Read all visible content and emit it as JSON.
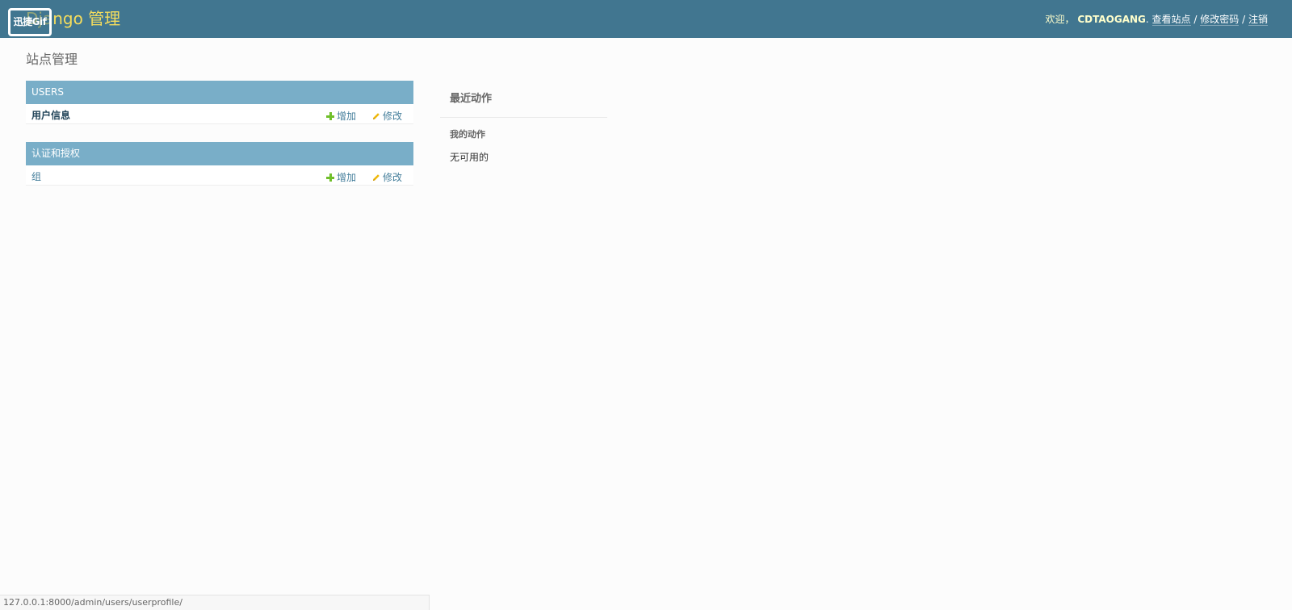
{
  "header": {
    "branding": "Django 管理",
    "watermark": "迅捷Gif",
    "welcome": "欢迎，",
    "username": "CDTAOGANG",
    "view_site": "查看站点",
    "change_password": "修改密码",
    "logout": "注销",
    "separator": "/"
  },
  "page": {
    "title": "站点管理"
  },
  "apps": [
    {
      "caption": "USERS",
      "models": [
        {
          "name": "用户信息",
          "add": "增加",
          "change": "修改"
        }
      ]
    },
    {
      "caption": "认证和授权",
      "models": [
        {
          "name": "组",
          "add": "增加",
          "change": "修改"
        }
      ]
    }
  ],
  "recent_actions": {
    "title": "最近动作",
    "my_actions": "我的动作",
    "none": "无可用的"
  },
  "status_bar": {
    "url": "127.0.0.1:8000/admin/users/userprofile/"
  },
  "colors": {
    "header_bg": "#417690",
    "branding": "#f5dd5d",
    "module_caption_bg": "#79aec8",
    "link": "#447e9b",
    "add_icon": "#70bf2b",
    "change_icon": "#efb80b"
  }
}
